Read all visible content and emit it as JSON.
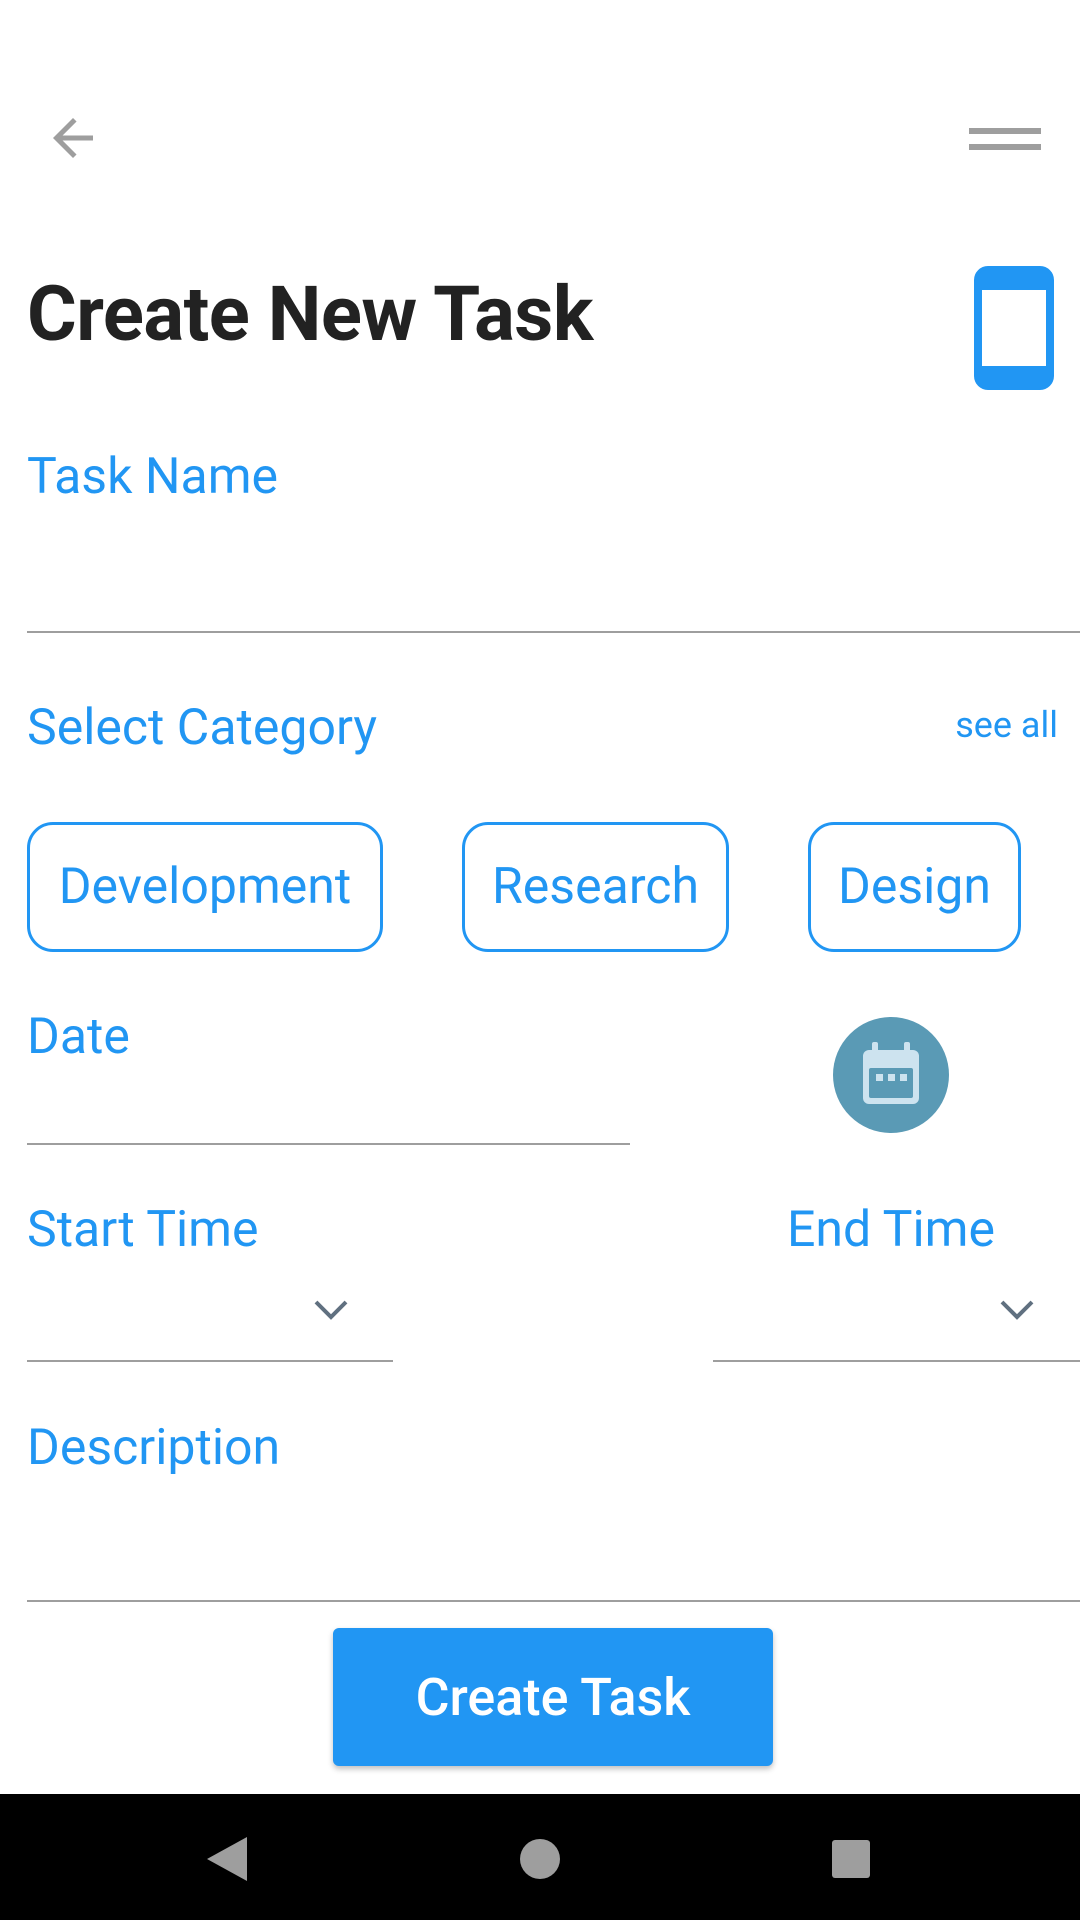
{
  "header": {
    "back_icon": "arrow-left-icon",
    "menu_icon": "menu-icon",
    "title": "Create New Task",
    "device_icon": "phone-icon"
  },
  "form": {
    "task_name": {
      "label": "Task Name",
      "value": ""
    },
    "category": {
      "label": "Select Category",
      "see_all": "see all",
      "chips": [
        "Development",
        "Research",
        "Design"
      ]
    },
    "date": {
      "label": "Date",
      "value": "",
      "calendar_icon": "calendar-icon"
    },
    "start_time": {
      "label": "Start Time",
      "value": ""
    },
    "end_time": {
      "label": "End Time",
      "value": ""
    },
    "description": {
      "label": "Description",
      "value": ""
    },
    "submit_label": "Create Task"
  },
  "colors": {
    "accent": "#2196f3",
    "title": "#222222",
    "calendar_bg": "#5a9ab5",
    "divider": "#9e9e9e",
    "nav_bar": "#000000"
  },
  "system_nav": {
    "back_icon": "nav-back-icon",
    "home_icon": "nav-home-icon",
    "recents_icon": "nav-recents-icon"
  }
}
